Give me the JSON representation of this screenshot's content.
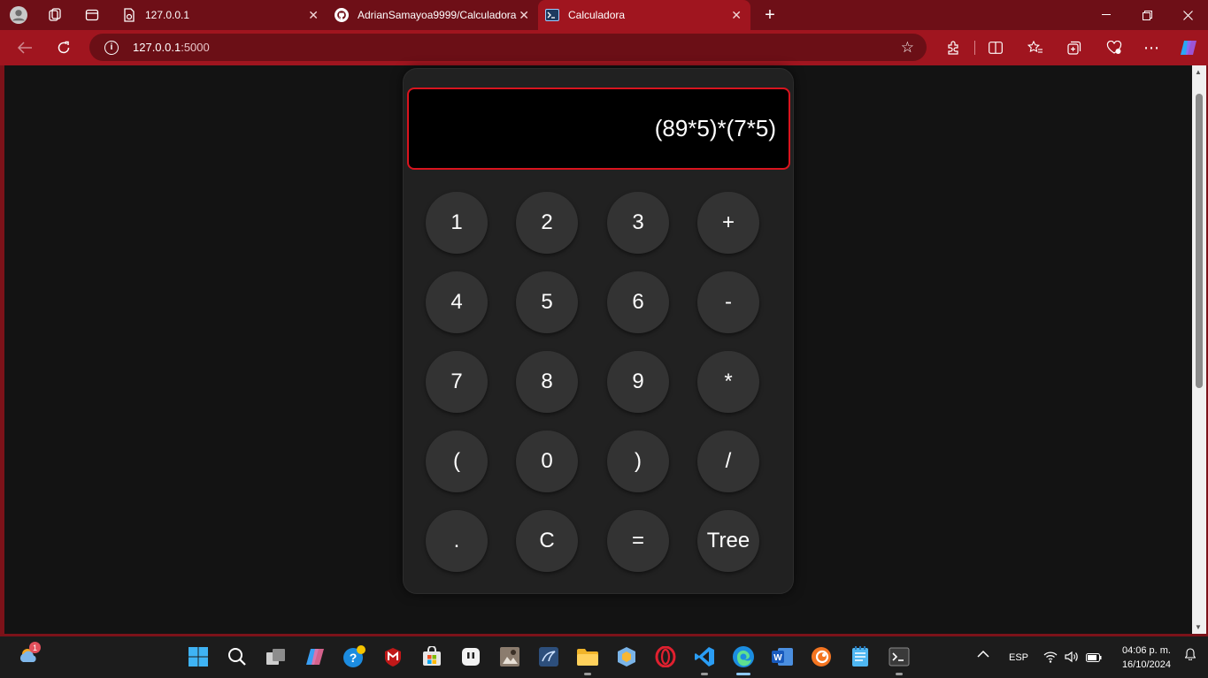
{
  "browser": {
    "tabs": [
      {
        "title": "127.0.0.1",
        "icon": "page-icon"
      },
      {
        "title": "AdrianSamayoa9999/Calculadora",
        "icon": "github-icon"
      },
      {
        "title": "Calculadora",
        "icon": "terminal-icon"
      }
    ],
    "url_host": "127.0.0.1",
    "url_port": ":5000"
  },
  "calculator": {
    "display": "(89*5)*(7*5)",
    "keys": [
      "1",
      "2",
      "3",
      "+",
      "4",
      "5",
      "6",
      "-",
      "7",
      "8",
      "9",
      "*",
      "(",
      "0",
      ")",
      "/",
      ".",
      "C",
      "=",
      "Tree"
    ]
  },
  "taskbar": {
    "weather_badge": "1",
    "language": "ESP",
    "time": "04:06 p. m.",
    "date": "16/10/2024"
  },
  "colors": {
    "accent": "#a0151f",
    "display_border": "#d9141e",
    "key_bg": "#333333"
  }
}
